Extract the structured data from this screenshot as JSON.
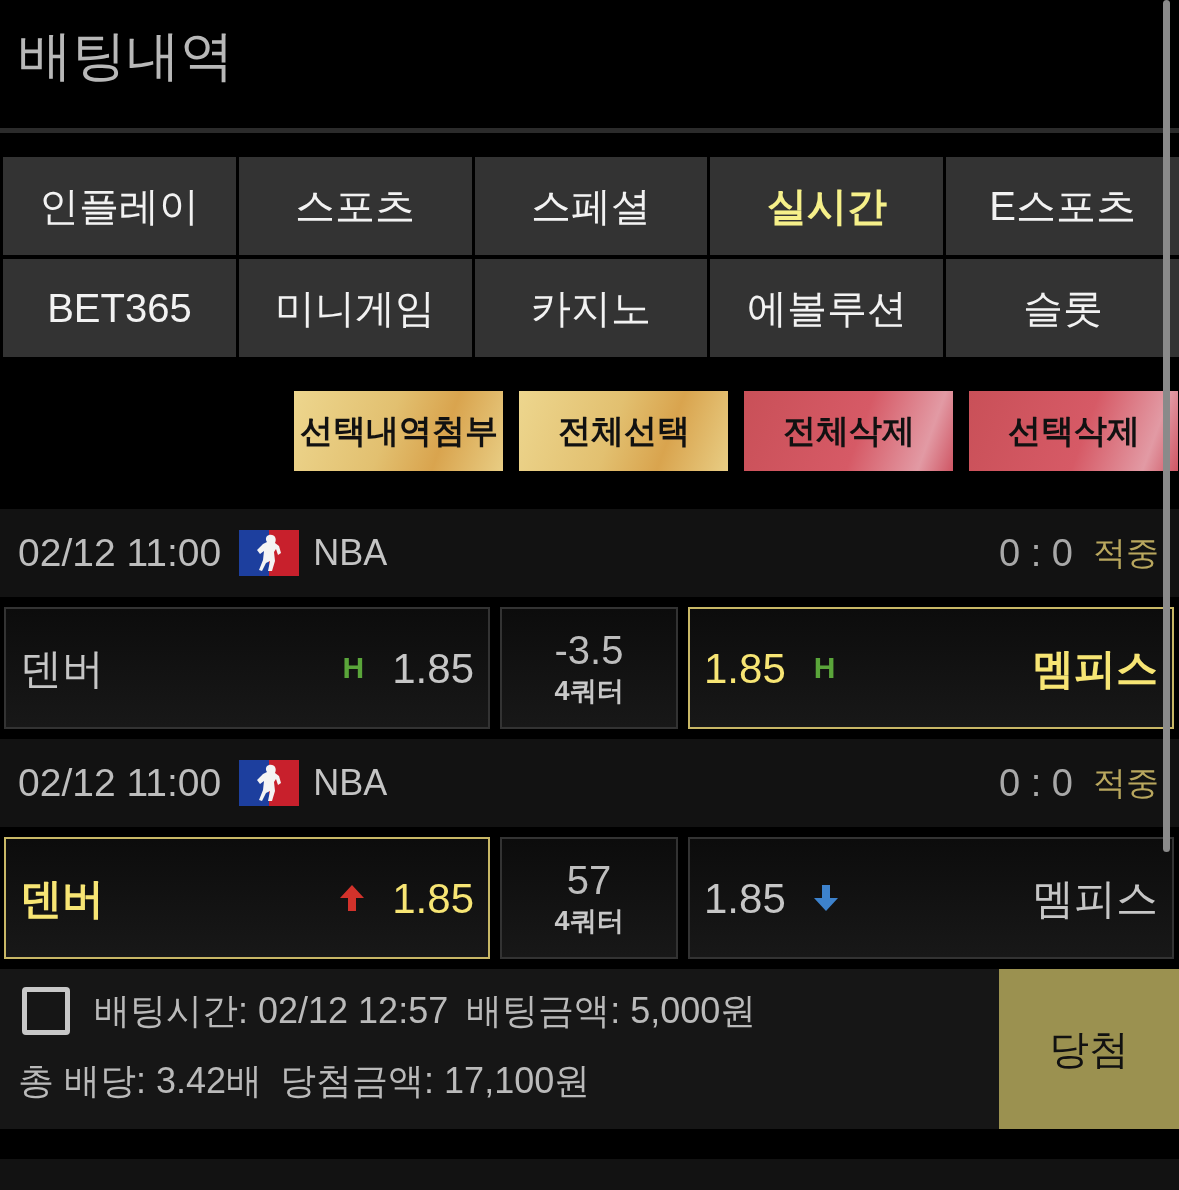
{
  "header": {
    "title": "배팅내역"
  },
  "tabs": [
    {
      "label": "인플레이",
      "selected": false
    },
    {
      "label": "스포츠",
      "selected": false
    },
    {
      "label": "스페셜",
      "selected": false
    },
    {
      "label": "실시간",
      "selected": true
    },
    {
      "label": "E스포츠",
      "selected": false
    },
    {
      "label": "BET365",
      "selected": false
    },
    {
      "label": "미니게임",
      "selected": false
    },
    {
      "label": "카지노",
      "selected": false
    },
    {
      "label": "에볼루션",
      "selected": false
    },
    {
      "label": "슬롯",
      "selected": false
    }
  ],
  "actions": [
    {
      "label": "선택내역첨부",
      "kind": "gold"
    },
    {
      "label": "전체선택",
      "kind": "gold"
    },
    {
      "label": "전체삭제",
      "kind": "red"
    },
    {
      "label": "선택삭제",
      "kind": "red"
    }
  ],
  "bets": [
    {
      "matches": [
        {
          "time": "02/12 11:00",
          "league": "NBA",
          "score": "0 : 0",
          "result": "적중",
          "home": {
            "team": "덴버",
            "odds": "1.85",
            "selected": false,
            "indicator": {
              "kind": "handicap",
              "text": "H"
            }
          },
          "line": {
            "value": "-3.5",
            "period": "4쿼터"
          },
          "away": {
            "team": "멤피스",
            "odds": "1.85",
            "selected": true,
            "indicator": {
              "kind": "handicap",
              "text": "H"
            }
          }
        },
        {
          "time": "02/12 11:00",
          "league": "NBA",
          "score": "0 : 0",
          "result": "적중",
          "home": {
            "team": "덴버",
            "odds": "1.85",
            "selected": true,
            "indicator": {
              "kind": "up"
            }
          },
          "line": {
            "value": "57",
            "period": "4쿼터"
          },
          "away": {
            "team": "멤피스",
            "odds": "1.85",
            "selected": false,
            "indicator": {
              "kind": "down"
            }
          }
        }
      ],
      "checked": false,
      "bet_time": "배팅시간: 02/12 12:57",
      "amount": "배팅금액: 5,000원",
      "total_odds": "총 배당: 3.42배",
      "payout": "당첨금액: 17,100원",
      "status": "당첨"
    }
  ]
}
